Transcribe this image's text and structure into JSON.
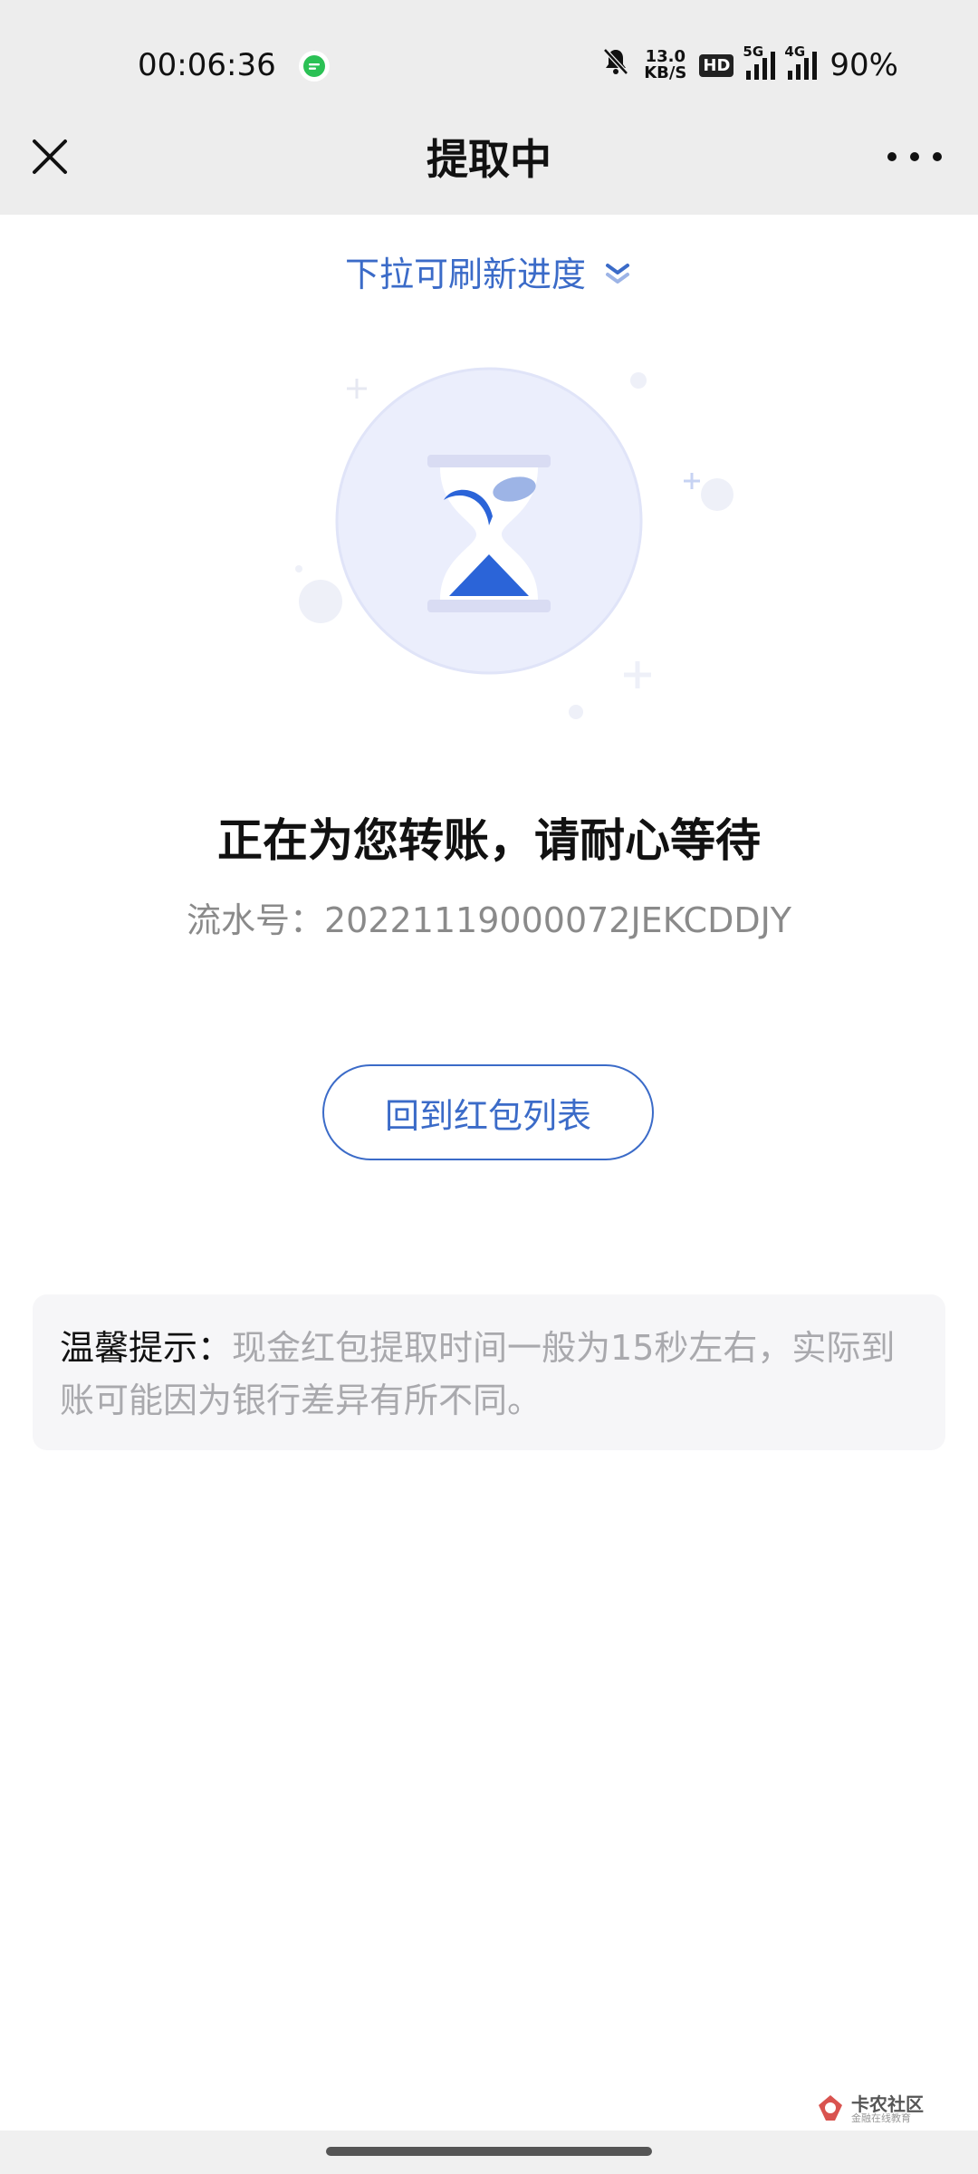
{
  "status_bar": {
    "time": "00:06:36",
    "net_speed_value": "13.0",
    "net_speed_unit": "KB/S",
    "hd_label": "HD",
    "sig1_label": "5G",
    "sig2_label": "4G",
    "battery": "90%"
  },
  "nav": {
    "title": "提取中"
  },
  "pull_hint": "下拉可刷新进度",
  "status": {
    "title": "正在为您转账，请耐心等待",
    "serial_label": "流水号：",
    "serial_value": "20221119000072JEKCDDJY"
  },
  "back_button": "回到红包列表",
  "tip": {
    "label": "温馨提示：",
    "text": "现金红包提取时间一般为15秒左右，实际到账可能因为银行差异有所不同。"
  },
  "watermark": {
    "title": "卡农社区",
    "subtitle": "金融在线教育"
  },
  "colors": {
    "accent": "#3b6bc8",
    "topbar": "#ededed"
  }
}
